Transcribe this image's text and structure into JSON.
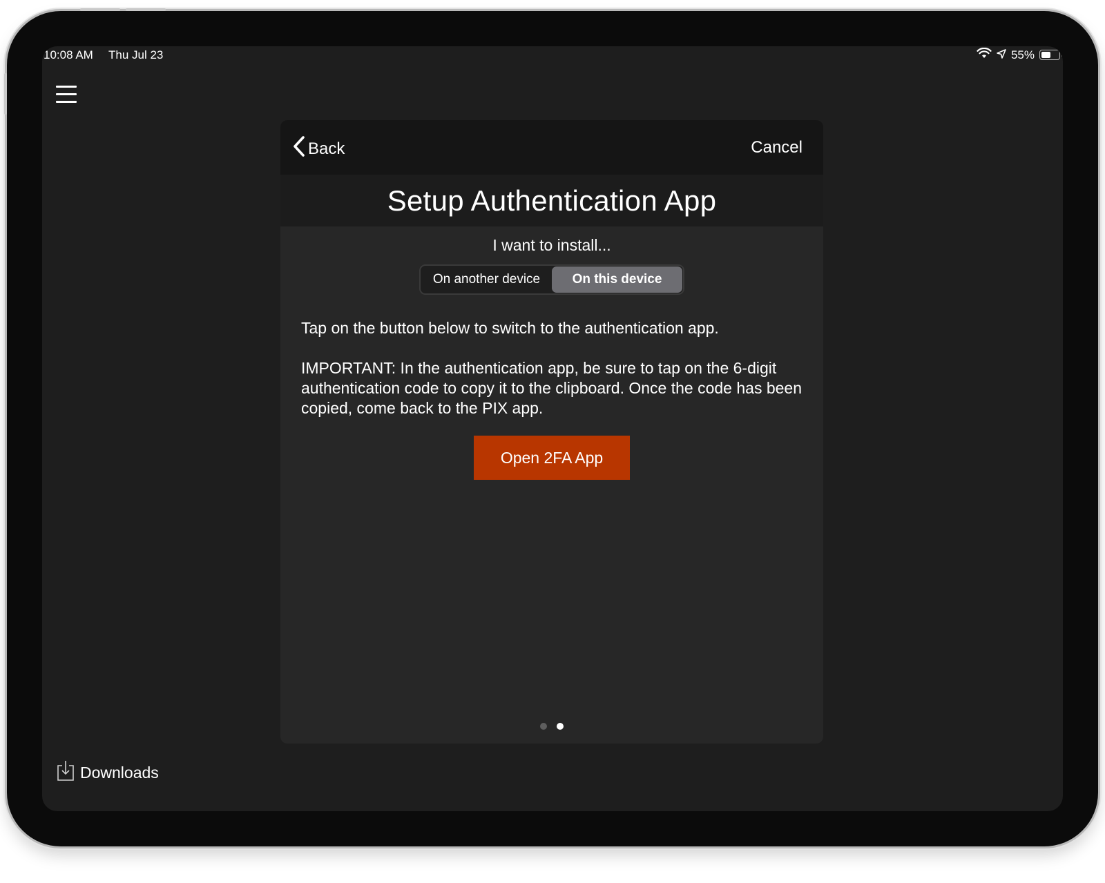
{
  "status_bar": {
    "time": "10:08 AM",
    "date": "Thu Jul 23",
    "battery_percent": "55%",
    "battery_level": 0.55,
    "icons": [
      "wifi-icon",
      "location-arrow-icon",
      "battery-icon"
    ]
  },
  "sidebar": {
    "menu_icon": "hamburger-menu-icon",
    "downloads_label": "Downloads",
    "downloads_icon": "download-tray-icon"
  },
  "modal": {
    "back_label": "Back",
    "back_icon": "chevron-left-icon",
    "cancel_label": "Cancel",
    "title": "Setup Authentication App",
    "subhead": "I want to install...",
    "segments": [
      {
        "label": "On another device",
        "selected": false
      },
      {
        "label": "On this device",
        "selected": true
      }
    ],
    "instruction": "Tap on the button below to switch to the authentication app.",
    "important": "IMPORTANT: In the authentication app, be sure to tap on the 6-digit authentication code to copy it to the clipboard. Once the code has been copied, come back to the PIX app.",
    "open_button_label": "Open 2FA App",
    "page_indicator": {
      "total": 2,
      "current": 2
    }
  },
  "colors": {
    "screen_bg": "#1e1e1e",
    "modal_bg": "#272727",
    "nav_bg": "#151515",
    "accent_button": "#b83600",
    "segment_selected": "#6d6d72"
  }
}
